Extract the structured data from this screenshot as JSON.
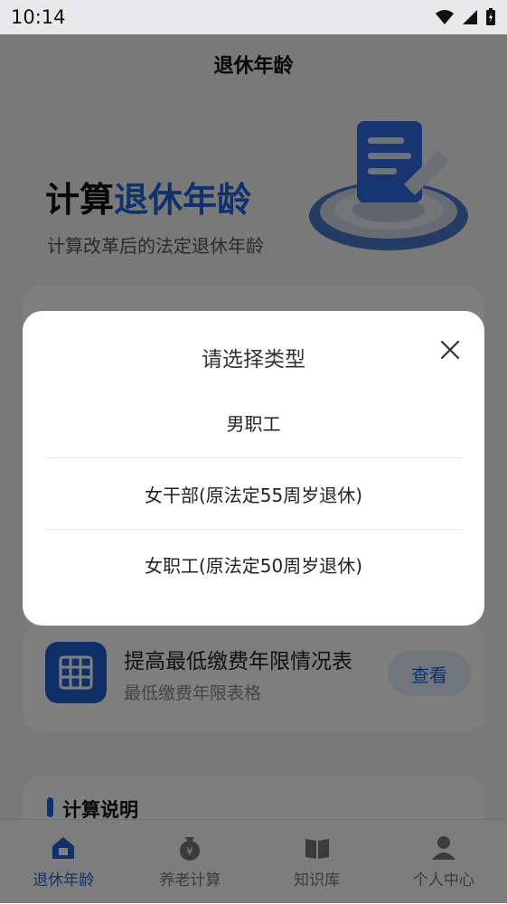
{
  "status_bar": {
    "time": "10:14"
  },
  "app_bar": {
    "title": "退休年龄"
  },
  "hero": {
    "title_prefix": "计算",
    "title_accent": "退休年龄",
    "subtitle": "计算改革后的法定退休年龄"
  },
  "table_card": {
    "title": "提高最低缴费年限情况表",
    "subtitle": "最低缴费年限表格",
    "view_label": "查看"
  },
  "calc_card": {
    "title": "计算说明"
  },
  "tabbar": {
    "tabs": [
      {
        "label": "退休年龄",
        "icon": "retire-icon",
        "active": true
      },
      {
        "label": "养老计算",
        "icon": "money-bag-icon",
        "active": false
      },
      {
        "label": "知识库",
        "icon": "book-icon",
        "active": false
      },
      {
        "label": "个人中心",
        "icon": "person-icon",
        "active": false
      }
    ]
  },
  "dialog": {
    "title": "请选择类型",
    "options": [
      "男职工",
      "女干部(原法定55周岁退休)",
      "女职工(原法定50周岁退休)"
    ]
  },
  "colors": {
    "accent": "#1f64d8",
    "overlay": "rgba(0,0,0,0.5)"
  }
}
